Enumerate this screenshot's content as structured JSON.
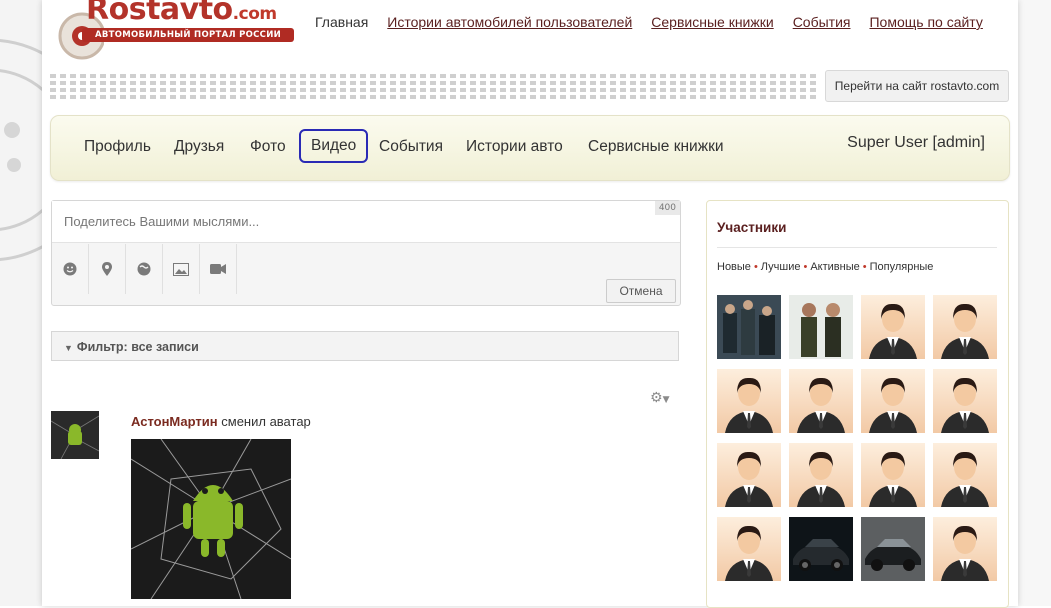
{
  "logo": {
    "name": "Rostavto",
    "domain": ".com",
    "tagline": "АВТОМОБИЛЬНЫЙ ПОРТАЛ РОССИИ"
  },
  "topnav": [
    "Главная",
    "Истории автомобилей пользователей",
    "Сервисные книжки",
    "События",
    "Помощь по сайту"
  ],
  "goto_site": "Перейти на сайт rostavto.com",
  "mainnav": {
    "items": [
      "Профиль",
      "Друзья",
      "Фото",
      "Видео",
      "События",
      "Истории авто",
      "Сервисные книжки"
    ],
    "highlighted": "Видео",
    "user": "Super User [admin]"
  },
  "post": {
    "placeholder": "Поделитесь Вашими мыслями...",
    "char_count": "400",
    "tools": [
      "smile-icon",
      "location-icon",
      "globe-icon",
      "image-icon",
      "video-icon"
    ],
    "cancel_label": "Отмена"
  },
  "filter": {
    "label": "Фильтр: все записи"
  },
  "activity": {
    "user": "АстонМартин",
    "action": "сменил аватар"
  },
  "sidebar": {
    "title": "Участники",
    "filters": [
      "Новые",
      "Лучшие",
      "Активные",
      "Популярные"
    ],
    "members": [
      "photo",
      "photo",
      "person",
      "person",
      "person",
      "person",
      "person",
      "person",
      "person",
      "person",
      "person",
      "person",
      "person",
      "car",
      "car",
      "person"
    ]
  },
  "colors": {
    "accent": "#5a1f1f",
    "brand": "#b3332a",
    "highlight": "#2a2ab5"
  }
}
